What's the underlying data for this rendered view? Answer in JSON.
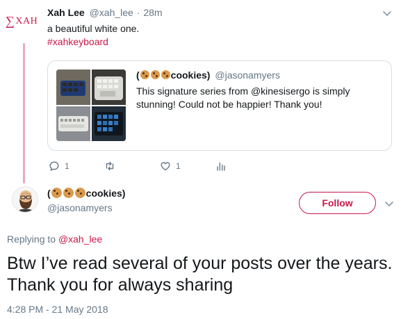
{
  "colors": {
    "accent": "#c9184a",
    "muted": "#657786",
    "text": "#14171a",
    "thread_line": "#e8a9bd",
    "border": "#d8dee3"
  },
  "parent_tweet": {
    "logo_text": "XAH",
    "logo_symbol": "∑",
    "author_name": "Xah Lee",
    "handle": "@xah_lee",
    "separator": "·",
    "time_ago": "28m",
    "text": "a beautiful white one.",
    "hashtag": "#xahkeyboard",
    "quote": {
      "author_open": "(",
      "author_icons": [
        "cookie-icon",
        "cookie-icon",
        "cookie-icon"
      ],
      "author_name": "cookies)",
      "handle": "@jasonamyers",
      "text": "This signature series from @kinesisergo is simply stunning! Could not be happier! Thank you!"
    },
    "actions": {
      "reply_count": "1",
      "retweet_count": "",
      "like_count": "1"
    }
  },
  "main_tweet": {
    "author_open": "(",
    "author_icons": [
      "cookie-icon",
      "cookie-icon",
      "cookie-icon"
    ],
    "author_name": "cookies)",
    "handle": "@jasonamyers",
    "follow_label": "Follow",
    "replying_label": "Replying to",
    "replying_handle": "@xah_lee",
    "text": "Btw I’ve read several of your posts over the years. Thank you for always sharing",
    "timestamp": "4:28 PM - 21 May 2018"
  }
}
